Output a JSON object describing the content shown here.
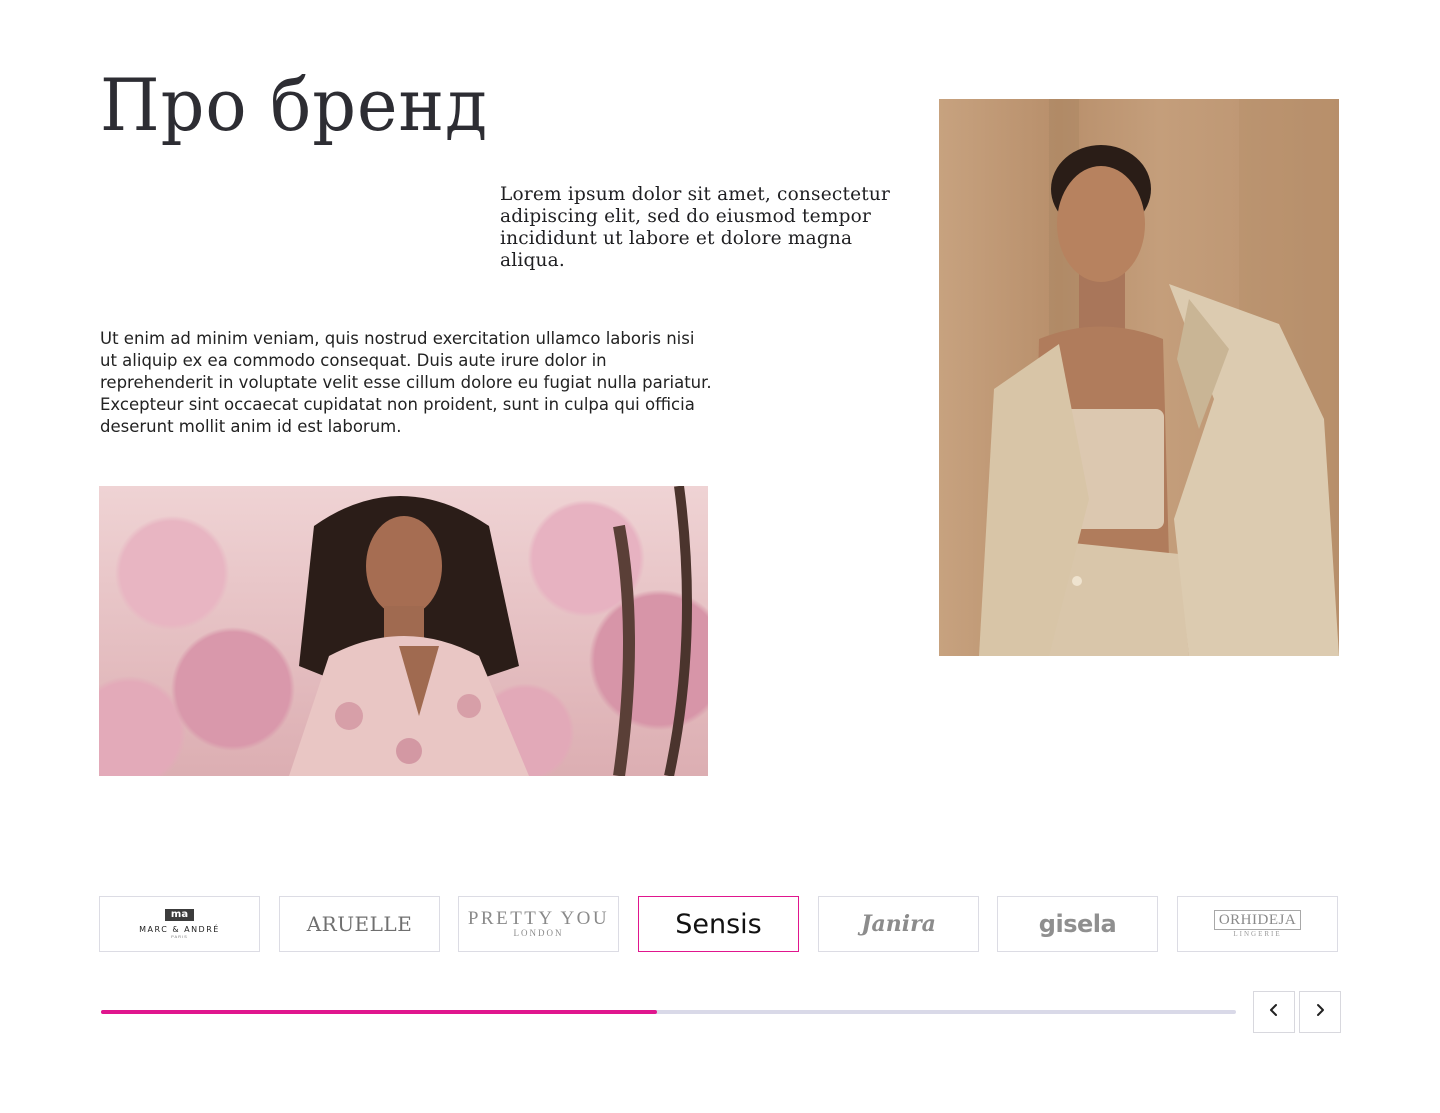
{
  "page": {
    "title": "Про бренд",
    "lead": "Lorem ipsum dolor sit amet, consectetur adipiscing elit, sed do eiusmod tempor incididunt ut labore et dolore magna aliqua.",
    "body": "Ut enim ad minim veniam, quis nostrud exercitation ullamco laboris nisi ut aliquip ex ea commodo consequat. Duis aute irure dolor in reprehenderit in voluptate velit esse cillum dolore eu fugiat nulla pariatur. Excepteur sint occaecat cupidatat non proident, sunt in culpa qui officia deserunt mollit anim id est laborum."
  },
  "brands": [
    {
      "logo_mark": "ma",
      "name": "MARC & ANDRÉ",
      "sub": "PARIS"
    },
    {
      "name": "ARUELLE"
    },
    {
      "name": "PRETTY YOU",
      "sub": "LONDON"
    },
    {
      "name": "Sensis",
      "active": true
    },
    {
      "name": "Janira"
    },
    {
      "name": "gisela"
    },
    {
      "name": "ORHIDEJA",
      "sub": "LINGERIE"
    }
  ],
  "slider": {
    "progress_fraction": 0.49
  },
  "colors": {
    "accent": "#e0168e",
    "track": "#d9d9e8",
    "border": "#dcdce4"
  },
  "icons": {
    "prev": "chevron-left-icon",
    "next": "chevron-right-icon"
  }
}
